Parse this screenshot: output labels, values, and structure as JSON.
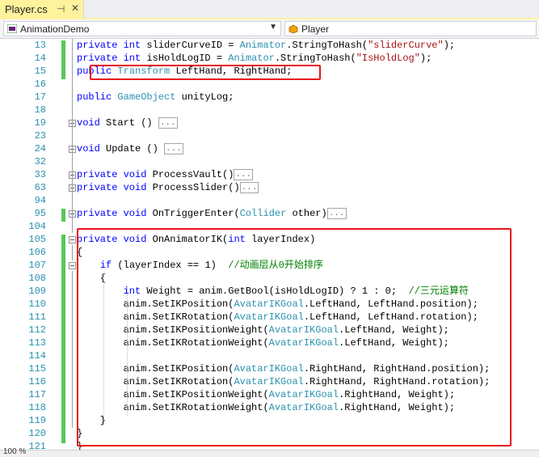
{
  "tab": {
    "title": "Player.cs",
    "pin_glyph": "⊣",
    "close_glyph": "✕"
  },
  "nav": {
    "project": "AnimationDemo",
    "class": "Player",
    "arrow_glyph": "▼"
  },
  "status": {
    "zoom": "100 %"
  },
  "colors": {
    "keyword": "#0000ff",
    "type": "#2b91af",
    "string": "#a31515",
    "comment": "#008000",
    "highlight": "#e8141c",
    "tab": "#fff29d"
  },
  "lines": [
    {
      "num": "13",
      "segs": [
        [
          "kw",
          "private int "
        ],
        [
          "",
          "sliderCurveID = "
        ],
        [
          "ty",
          "Animator"
        ],
        [
          "",
          ".StringToHash("
        ],
        [
          "st",
          "\"sliderCurve\""
        ],
        [
          "",
          ");"
        ]
      ]
    },
    {
      "num": "14",
      "segs": [
        [
          "kw",
          "private int "
        ],
        [
          "",
          "isHoldLogID = "
        ],
        [
          "ty",
          "Animator"
        ],
        [
          "",
          ".StringToHash("
        ],
        [
          "st",
          "\"IsHoldLog\""
        ],
        [
          "",
          ");"
        ]
      ]
    },
    {
      "num": "15",
      "segs": [
        [
          "kw",
          "public "
        ],
        [
          "ty",
          "Transform "
        ],
        [
          "",
          "LeftHand, RightHand;"
        ]
      ]
    },
    {
      "num": "16",
      "segs": []
    },
    {
      "num": "17",
      "segs": [
        [
          "kw",
          "public "
        ],
        [
          "ty",
          "GameObject "
        ],
        [
          "",
          "unityLog;"
        ]
      ]
    },
    {
      "num": "18",
      "segs": []
    },
    {
      "num": "19",
      "segs": [
        [
          "kw",
          "void "
        ],
        [
          "",
          "Start () "
        ],
        [
          "fold",
          "..."
        ]
      ]
    },
    {
      "num": "23",
      "segs": []
    },
    {
      "num": "24",
      "segs": [
        [
          "kw",
          "void "
        ],
        [
          "",
          "Update () "
        ],
        [
          "fold",
          "..."
        ]
      ]
    },
    {
      "num": "32",
      "segs": []
    },
    {
      "num": "33",
      "segs": [
        [
          "kw",
          "private void "
        ],
        [
          "",
          "ProcessVault()"
        ],
        [
          "fold",
          "..."
        ]
      ]
    },
    {
      "num": "63",
      "segs": [
        [
          "kw",
          "private void "
        ],
        [
          "",
          "ProcessSlider()"
        ],
        [
          "fold",
          "..."
        ]
      ]
    },
    {
      "num": "94",
      "segs": []
    },
    {
      "num": "95",
      "segs": [
        [
          "kw",
          "private void "
        ],
        [
          "",
          "OnTriggerEnter("
        ],
        [
          "ty",
          "Collider "
        ],
        [
          "",
          "other)"
        ],
        [
          "fold",
          "..."
        ]
      ]
    },
    {
      "num": "104",
      "segs": []
    },
    {
      "num": "105",
      "segs": [
        [
          "kw",
          "private void "
        ],
        [
          "",
          "OnAnimatorIK("
        ],
        [
          "kw",
          "int "
        ],
        [
          "",
          "layerIndex)"
        ]
      ]
    },
    {
      "num": "106",
      "segs": [
        [
          "",
          "{"
        ]
      ]
    },
    {
      "num": "107",
      "segs": [
        [
          "",
          "    "
        ],
        [
          "kw",
          "if "
        ],
        [
          "",
          "(layerIndex == 1)  "
        ],
        [
          "cm",
          "//动画层从0开始排序"
        ]
      ]
    },
    {
      "num": "108",
      "segs": [
        [
          "",
          "    {"
        ]
      ]
    },
    {
      "num": "109",
      "segs": [
        [
          "",
          "        "
        ],
        [
          "kw",
          "int "
        ],
        [
          "",
          "Weight = anim.GetBool(isHoldLogID) ? 1 : 0;  "
        ],
        [
          "cm",
          "//三元运算符"
        ]
      ]
    },
    {
      "num": "110",
      "segs": [
        [
          "",
          "        anim.SetIKPosition("
        ],
        [
          "ty",
          "AvatarIKGoal"
        ],
        [
          "",
          ".LeftHand, LeftHand.position);"
        ]
      ]
    },
    {
      "num": "111",
      "segs": [
        [
          "",
          "        anim.SetIKRotation("
        ],
        [
          "ty",
          "AvatarIKGoal"
        ],
        [
          "",
          ".LeftHand, LeftHand.rotation);"
        ]
      ]
    },
    {
      "num": "112",
      "segs": [
        [
          "",
          "        anim.SetIKPositionWeight("
        ],
        [
          "ty",
          "AvatarIKGoal"
        ],
        [
          "",
          ".LeftHand, Weight);"
        ]
      ]
    },
    {
      "num": "113",
      "segs": [
        [
          "",
          "        anim.SetIKRotationWeight("
        ],
        [
          "ty",
          "AvatarIKGoal"
        ],
        [
          "",
          ".LeftHand, Weight);"
        ]
      ]
    },
    {
      "num": "114",
      "segs": []
    },
    {
      "num": "115",
      "segs": [
        [
          "",
          "        anim.SetIKPosition("
        ],
        [
          "ty",
          "AvatarIKGoal"
        ],
        [
          "",
          ".RightHand, RightHand.position);"
        ]
      ]
    },
    {
      "num": "116",
      "segs": [
        [
          "",
          "        anim.SetIKRotation("
        ],
        [
          "ty",
          "AvatarIKGoal"
        ],
        [
          "",
          ".RightHand, RightHand.rotation);"
        ]
      ]
    },
    {
      "num": "117",
      "segs": [
        [
          "",
          "        anim.SetIKPositionWeight("
        ],
        [
          "ty",
          "AvatarIKGoal"
        ],
        [
          "",
          ".RightHand, Weight);"
        ]
      ]
    },
    {
      "num": "118",
      "segs": [
        [
          "",
          "        anim.SetIKRotationWeight("
        ],
        [
          "ty",
          "AvatarIKGoal"
        ],
        [
          "",
          ".RightHand, Weight);"
        ]
      ]
    },
    {
      "num": "119",
      "segs": [
        [
          "",
          "    }"
        ]
      ]
    },
    {
      "num": "120",
      "segs": [
        [
          "",
          "}"
        ]
      ]
    },
    {
      "num": "121",
      "segs": [
        [
          "",
          "}"
        ]
      ]
    }
  ]
}
